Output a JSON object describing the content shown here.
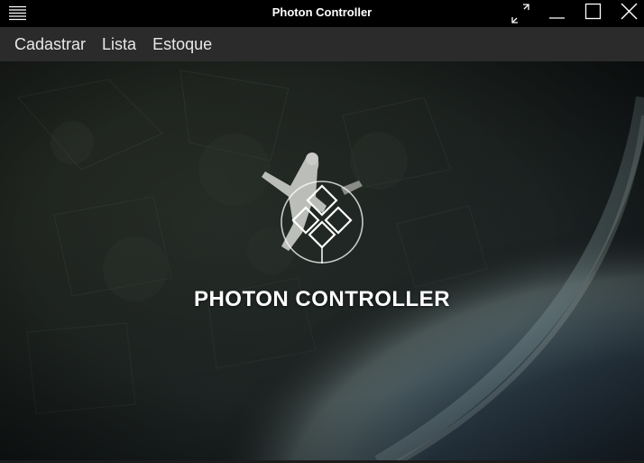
{
  "window": {
    "title": "Photon Controller",
    "controls": [
      "fullscreen-icon",
      "minimize-icon",
      "maximize-icon",
      "close-icon"
    ]
  },
  "menu": {
    "items": [
      {
        "label": "Cadastrar"
      },
      {
        "label": "Lista"
      },
      {
        "label": "Estoque"
      }
    ]
  },
  "splash": {
    "brand": "PHOTON CONTROLLER",
    "logo_icon": "photon-diamond-logo-icon",
    "background": "skydiver-over-earth-image"
  },
  "colors": {
    "titlebar": "#000000",
    "menubar": "#2b2b2b",
    "text": "#ffffff"
  }
}
